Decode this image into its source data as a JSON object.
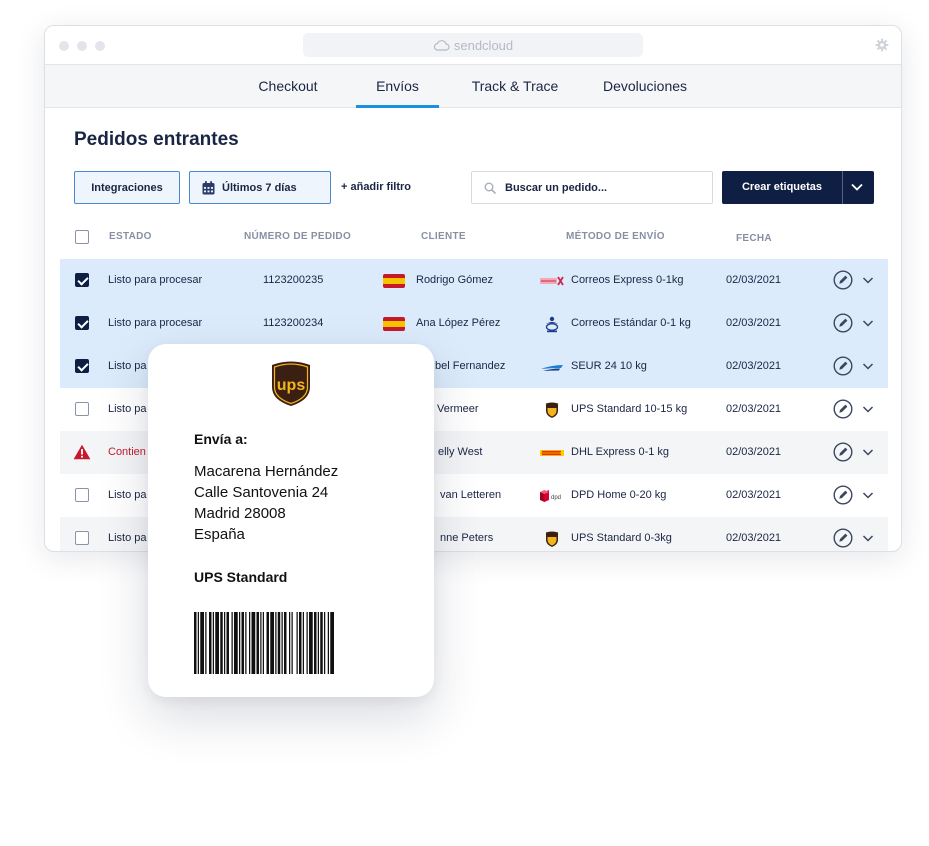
{
  "browser": {
    "url": "sendcloud",
    "icons": {
      "cloud": "cloud-icon",
      "settings": "gear-icon"
    }
  },
  "nav": {
    "tabs": [
      {
        "label": "Checkout",
        "active": false
      },
      {
        "label": "Envíos",
        "active": true
      },
      {
        "label": "Track & Trace",
        "active": false
      },
      {
        "label": "Devoluciones",
        "active": false
      }
    ]
  },
  "page": {
    "title": "Pedidos entrantes"
  },
  "toolbar": {
    "integrations_label": "Integraciones",
    "date_filter_label": "Últimos 7 días",
    "add_filter_label": "+ añadir filtro",
    "search_placeholder": "Buscar un pedido...",
    "create_labels": "Crear etiquetas"
  },
  "table": {
    "headers": [
      "ESTADO",
      "NÚMERO DE PEDIDO",
      "CLIENTE",
      "MÉTODO DE ENVÍO",
      "FECHA"
    ],
    "rows": [
      {
        "checked": true,
        "status": "Listo para procesar",
        "order": "1123200235",
        "customer": "Rodrigo Gómez",
        "method": "Correos Express 0-1kg",
        "date": "02/03/2021",
        "carrier": "correos-express"
      },
      {
        "checked": true,
        "status": "Listo para procesar",
        "order": "1123200234",
        "customer": "Ana López Pérez",
        "method": "Correos Estándar 0-1 kg",
        "date": "02/03/2021",
        "carrier": "correos"
      },
      {
        "checked": true,
        "status": "Listo pa",
        "order": "",
        "customer": "bel Fernandez",
        "method": "SEUR 24 10 kg",
        "date": "02/03/2021",
        "carrier": "seur"
      },
      {
        "checked": false,
        "status": "Listo pa",
        "order": "",
        "customer": "Vermeer",
        "method": "UPS Standard 10-15 kg",
        "date": "02/03/2021",
        "carrier": "ups"
      },
      {
        "checked": false,
        "status": "Contien",
        "order": "",
        "customer": "elly West",
        "method": "DHL Express 0-1 kg",
        "date": "02/03/2021",
        "carrier": "dhl",
        "error": true
      },
      {
        "checked": false,
        "status": "Listo pa",
        "order": "",
        "customer": "van Letteren",
        "method": "DPD Home 0-20 kg",
        "date": "02/03/2021",
        "carrier": "dpd"
      },
      {
        "checked": false,
        "status": "Listo pa",
        "order": "",
        "customer": "nne Peters",
        "method": "UPS Standard 0-3kg",
        "date": "02/03/2021",
        "carrier": "ups"
      }
    ]
  },
  "label": {
    "logo_text": "ups",
    "ship_to": "Envía a:",
    "name": "Macarena Hernández",
    "street": "Calle Santovenia 24",
    "city": "Madrid 28008",
    "country": "España",
    "service": "UPS Standard"
  },
  "colors": {
    "navy": "#0f1f44",
    "accent_blue": "#1e8fe0",
    "selected_row": "#dcebfb",
    "error_red": "#c7192e",
    "ups_brown": "#3a1f12",
    "ups_gold": "#f3b51d"
  }
}
